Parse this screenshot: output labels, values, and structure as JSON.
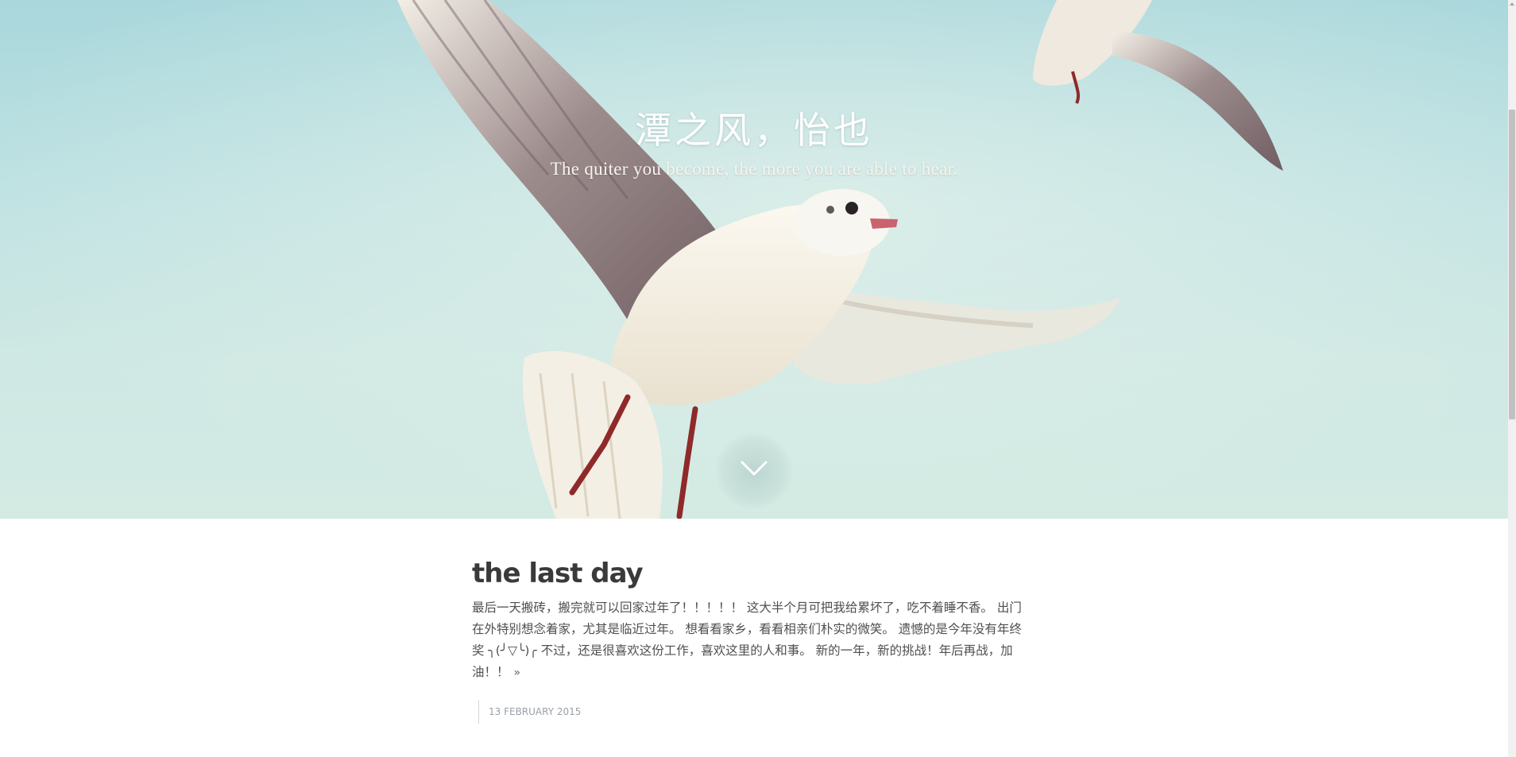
{
  "hero": {
    "title": "潭之风，怡也",
    "subtitle": "The quiter you become, the more you are able to hear.",
    "scroll_icon": "chevron-down-icon",
    "photo_subject": "seagulls-in-sky"
  },
  "post": {
    "title": "the last day",
    "excerpt": "最后一天搬砖，搬完就可以回家过年了！！！！！ 这大半个月可把我给累坏了，吃不着睡不香。 出门在外特别想念着家，尤其是临近过年。 想看看家乡，看看相亲们朴实的微笑。 遗憾的是今年没有年终奖 ╮(╯▽╰)╭ 不过，还是很喜欢这份工作，喜欢这里的人和事。 新的一年，新的挑战！年后再战，加油！！",
    "read_more": "»",
    "date": "13 February 2015"
  },
  "colors": {
    "sky_top": "#a9d7dc",
    "sky_bottom": "#d4ebe4",
    "title_text": "#3a3a3a",
    "body_text": "#4f4f4f",
    "meta_text": "#9aa0a6"
  }
}
